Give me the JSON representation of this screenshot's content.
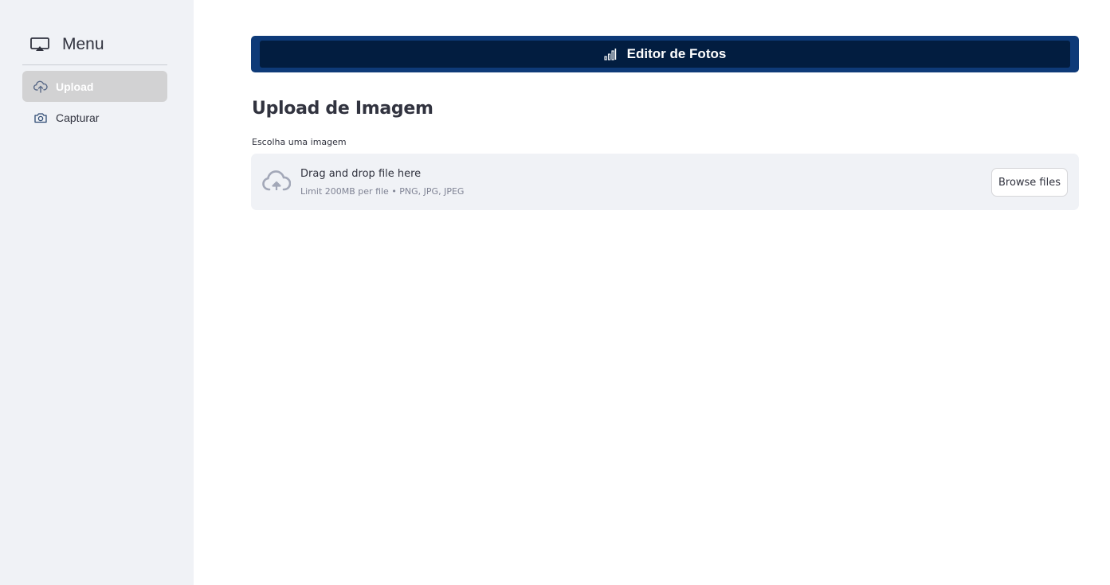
{
  "sidebar": {
    "title": "Menu",
    "items": [
      {
        "label": "Upload",
        "icon": "cloud-upload-icon",
        "active": true
      },
      {
        "label": "Capturar",
        "icon": "camera-icon",
        "active": false
      }
    ]
  },
  "banner": {
    "title": "Editor de Fotos",
    "icon": "bar-chart-icon"
  },
  "main": {
    "heading": "Upload de Imagem",
    "uploader": {
      "label": "Escolha uma imagem",
      "drop_text": "Drag and drop file here",
      "limit_text": "Limit 200MB per file • PNG, JPG, JPEG",
      "button_label": "Browse files"
    }
  },
  "colors": {
    "sidebar_bg": "#f0f2f6",
    "banner_outer": "#0e3a78",
    "banner_inner": "#021d40",
    "active_item_bg": "#d2d2d3"
  }
}
